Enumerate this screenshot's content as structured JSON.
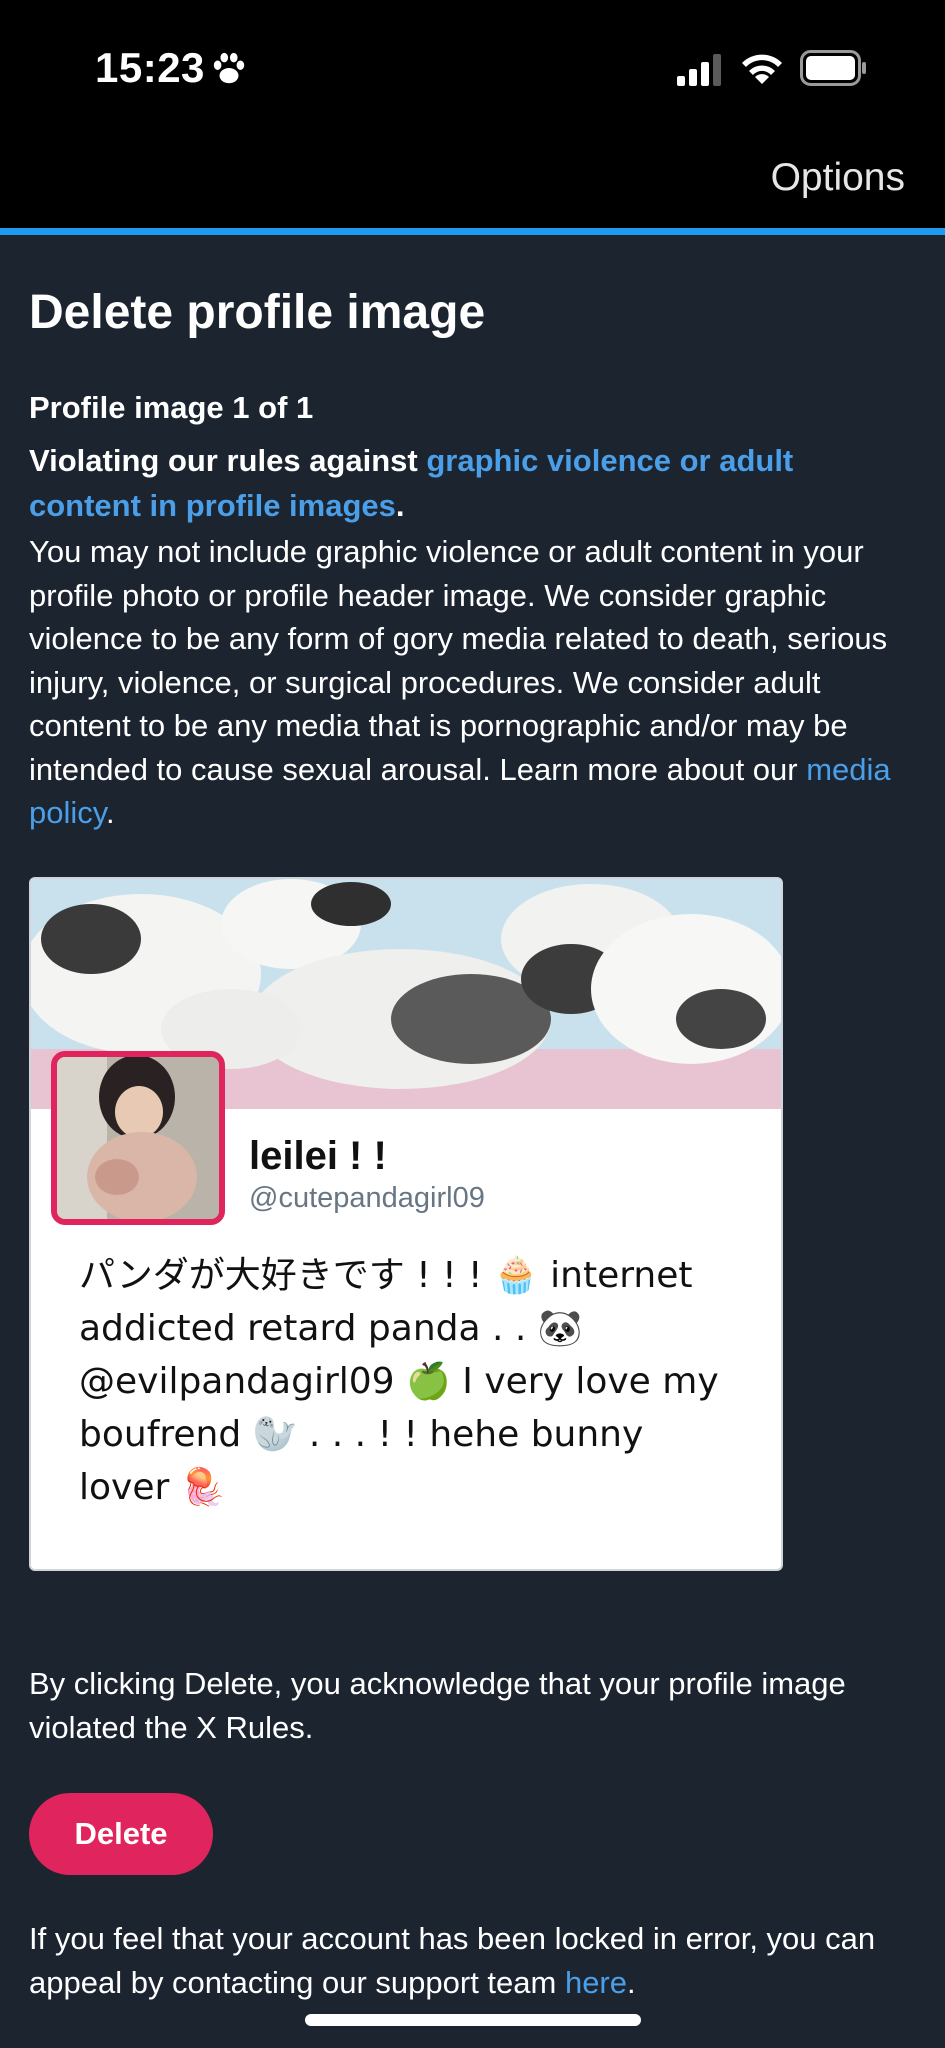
{
  "status_bar": {
    "time": "15:23"
  },
  "nav": {
    "options_label": "Options"
  },
  "page": {
    "title": "Delete profile image",
    "image_count": "Profile image 1 of 1",
    "violation_prefix": "Violating our rules against ",
    "violation_link": "graphic violence or adult content in profile images",
    "violation_suffix": ".",
    "description_text": "You may not include graphic violence or adult content in your profile photo or profile header image. We consider graphic violence to be any form of gory media related to death, serious injury, violence, or surgical procedures. We consider adult content to be any media that is pornographic and/or may be intended to cause sexual arousal. Learn more about our ",
    "description_link": "media policy",
    "description_suffix": "."
  },
  "profile_card": {
    "display_name": "leilei ! !",
    "handle": "@cutepandagirl09",
    "bio": "パンダが大好きです ! ! ! 🧁 internet addicted retard panda . . 🐼 @evilpandagirl09 🍏 I very love my boufrend 🦭 . . . ! ! hehe bunny lover 🪼"
  },
  "footer": {
    "acknowledge_text": "By clicking Delete, you acknowledge that your profile image violated the X Rules.",
    "delete_label": "Delete",
    "appeal_text": "If you feel that your account has been locked in error, you can appeal by contacting our support team ",
    "appeal_link": "here",
    "appeal_suffix": "."
  },
  "colors": {
    "background": "#1c2430",
    "accent_blue": "#1d9bf0",
    "link_blue": "#4a9fe8",
    "delete_red": "#e0245e"
  }
}
